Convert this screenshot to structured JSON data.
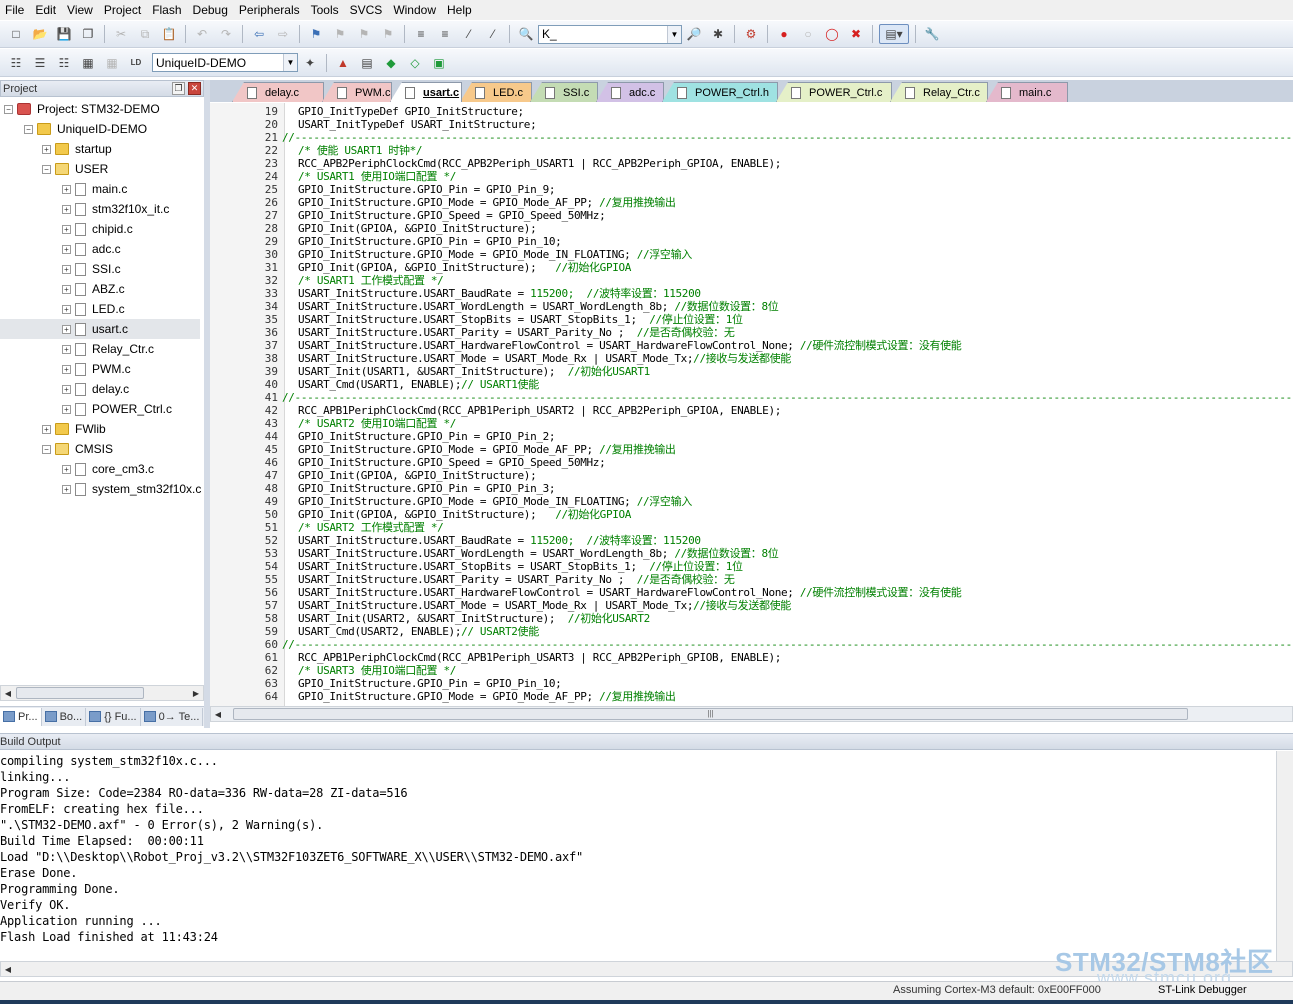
{
  "menu": [
    "File",
    "Edit",
    "View",
    "Project",
    "Flash",
    "Debug",
    "Peripherals",
    "Tools",
    "SVCS",
    "Window",
    "Help"
  ],
  "toolbar": {
    "find_value": "K_",
    "target_value": "UniqueID-DEMO"
  },
  "project_pane": {
    "title": "Project",
    "pin_glyph": "❐",
    "close_glyph": "✕",
    "tree": [
      {
        "label": "Project: STM32-DEMO",
        "kind": "project",
        "indent": 0,
        "expander": "−"
      },
      {
        "label": "UniqueID-DEMO",
        "kind": "target",
        "indent": 1,
        "expander": "−"
      },
      {
        "label": "startup",
        "kind": "folder",
        "indent": 2,
        "expander": "+"
      },
      {
        "label": "USER",
        "kind": "folder-open",
        "indent": 2,
        "expander": "−"
      },
      {
        "label": "main.c",
        "kind": "file",
        "indent": 3,
        "expander": "+"
      },
      {
        "label": "stm32f10x_it.c",
        "kind": "file",
        "indent": 3,
        "expander": "+"
      },
      {
        "label": "chipid.c",
        "kind": "file",
        "indent": 3,
        "expander": "+"
      },
      {
        "label": "adc.c",
        "kind": "file",
        "indent": 3,
        "expander": "+"
      },
      {
        "label": "SSI.c",
        "kind": "file",
        "indent": 3,
        "expander": "+"
      },
      {
        "label": "ABZ.c",
        "kind": "file",
        "indent": 3,
        "expander": "+"
      },
      {
        "label": "LED.c",
        "kind": "file",
        "indent": 3,
        "expander": "+"
      },
      {
        "label": "usart.c",
        "kind": "file",
        "indent": 3,
        "expander": "+",
        "selected": true
      },
      {
        "label": "Relay_Ctr.c",
        "kind": "file",
        "indent": 3,
        "expander": "+"
      },
      {
        "label": "PWM.c",
        "kind": "file",
        "indent": 3,
        "expander": "+"
      },
      {
        "label": "delay.c",
        "kind": "file",
        "indent": 3,
        "expander": "+"
      },
      {
        "label": "POWER_Ctrl.c",
        "kind": "file",
        "indent": 3,
        "expander": "+"
      },
      {
        "label": "FWlib",
        "kind": "folder",
        "indent": 2,
        "expander": "+"
      },
      {
        "label": "CMSIS",
        "kind": "folder-open",
        "indent": 2,
        "expander": "−"
      },
      {
        "label": "core_cm3.c",
        "kind": "file",
        "indent": 3,
        "expander": "+"
      },
      {
        "label": "system_stm32f10x.c",
        "kind": "file",
        "indent": 3,
        "expander": "+"
      }
    ],
    "bottom_tabs": [
      {
        "label": "Pr...",
        "active": true
      },
      {
        "label": "Bo...",
        "active": false
      },
      {
        "label": "{} Fu...",
        "active": false
      },
      {
        "label": "0→ Te...",
        "active": false
      }
    ]
  },
  "editor_tabs": [
    {
      "label": "delay.c",
      "color": "#f1c6c6",
      "active": false
    },
    {
      "label": "PWM.c",
      "color": "#f1c6c6",
      "active": false
    },
    {
      "label": "usart.c",
      "color": "#ffffff",
      "active": true
    },
    {
      "label": "LED.c",
      "color": "#f7c98b",
      "active": false
    },
    {
      "label": "SSI.c",
      "color": "#c4dcb4",
      "active": false
    },
    {
      "label": "adc.c",
      "color": "#d2c1e6",
      "active": false
    },
    {
      "label": "POWER_Ctrl.h",
      "color": "#9fe2e2",
      "active": false
    },
    {
      "label": "POWER_Ctrl.c",
      "color": "#e5f0c8",
      "active": false
    },
    {
      "label": "Relay_Ctr.c",
      "color": "#e5f0c8",
      "active": false
    },
    {
      "label": "main.c",
      "color": "#e4b9cc",
      "active": false
    }
  ],
  "code": {
    "first_line": 19,
    "lines": [
      {
        "code": "GPIO_InitTypeDef GPIO_InitStructure;",
        "comment": ""
      },
      {
        "code": "USART_InitTypeDef USART_InitStructure;",
        "comment": ""
      },
      {
        "code": "",
        "comment": "",
        "separator": true
      },
      {
        "code": "",
        "comment": "/* 使能 USART1 时钟*/"
      },
      {
        "code": "RCC_APB2PeriphClockCmd(RCC_APB2Periph_USART1 | RCC_APB2Periph_GPIOA, ENABLE);",
        "comment": ""
      },
      {
        "code": "",
        "comment": "/* USART1 使用IO端口配置 */"
      },
      {
        "code": "GPIO_InitStructure.GPIO_Pin = GPIO_Pin_9;",
        "comment": ""
      },
      {
        "code": "GPIO_InitStructure.GPIO_Mode = GPIO_Mode_AF_PP; ",
        "comment": "//复用推挽输出"
      },
      {
        "code": "GPIO_InitStructure.GPIO_Speed = GPIO_Speed_50MHz;",
        "comment": ""
      },
      {
        "code": "GPIO_Init(GPIOA, &GPIO_InitStructure);",
        "comment": ""
      },
      {
        "code": "GPIO_InitStructure.GPIO_Pin = GPIO_Pin_10;",
        "comment": ""
      },
      {
        "code": "GPIO_InitStructure.GPIO_Mode = GPIO_Mode_IN_FLOATING; ",
        "comment": "//浮空输入"
      },
      {
        "code": "GPIO_Init(GPIOA, &GPIO_InitStructure);   ",
        "comment": "//初始化GPIOA"
      },
      {
        "code": "",
        "comment": "/* USART1 工作模式配置 */"
      },
      {
        "code": "USART_InitStructure.USART_BaudRate = ",
        "comment": "115200;  //波特率设置：115200"
      },
      {
        "code": "USART_InitStructure.USART_WordLength = USART_WordLength_8b; ",
        "comment": "//数据位数设置：8位"
      },
      {
        "code": "USART_InitStructure.USART_StopBits = USART_StopBits_1;  ",
        "comment": "//停止位设置：1位"
      },
      {
        "code": "USART_InitStructure.USART_Parity = USART_Parity_No ;  ",
        "comment": "//是否奇偶校验：无"
      },
      {
        "code": "USART_InitStructure.USART_HardwareFlowControl = USART_HardwareFlowControl_None; ",
        "comment": "//硬件流控制模式设置：没有使能"
      },
      {
        "code": "USART_InitStructure.USART_Mode = USART_Mode_Rx | USART_Mode_Tx;",
        "comment": "//接收与发送都使能"
      },
      {
        "code": "USART_Init(USART1, &USART_InitStructure);  ",
        "comment": "//初始化USART1"
      },
      {
        "code": "USART_Cmd(USART1, ENABLE);",
        "comment": "// USART1使能"
      },
      {
        "code": "",
        "comment": "",
        "separator": true
      },
      {
        "code": "RCC_APB1PeriphClockCmd(RCC_APB1Periph_USART2 | RCC_APB2Periph_GPIOA, ENABLE);",
        "comment": ""
      },
      {
        "code": "",
        "comment": "/* USART2 使用IO端口配置 */"
      },
      {
        "code": "GPIO_InitStructure.GPIO_Pin = GPIO_Pin_2;",
        "comment": ""
      },
      {
        "code": "GPIO_InitStructure.GPIO_Mode = GPIO_Mode_AF_PP; ",
        "comment": "//复用推挽输出"
      },
      {
        "code": "GPIO_InitStructure.GPIO_Speed = GPIO_Speed_50MHz;",
        "comment": ""
      },
      {
        "code": "GPIO_Init(GPIOA, &GPIO_InitStructure);",
        "comment": ""
      },
      {
        "code": "GPIO_InitStructure.GPIO_Pin = GPIO_Pin_3;",
        "comment": ""
      },
      {
        "code": "GPIO_InitStructure.GPIO_Mode = GPIO_Mode_IN_FLOATING; ",
        "comment": "//浮空输入"
      },
      {
        "code": "GPIO_Init(GPIOA, &GPIO_InitStructure);   ",
        "comment": "//初始化GPIOA"
      },
      {
        "code": "",
        "comment": "/* USART2 工作模式配置 */"
      },
      {
        "code": "USART_InitStructure.USART_BaudRate = ",
        "comment": "115200;  //波特率设置：115200"
      },
      {
        "code": "USART_InitStructure.USART_WordLength = USART_WordLength_8b; ",
        "comment": "//数据位数设置：8位"
      },
      {
        "code": "USART_InitStructure.USART_StopBits = USART_StopBits_1;  ",
        "comment": "//停止位设置：1位"
      },
      {
        "code": "USART_InitStructure.USART_Parity = USART_Parity_No ;  ",
        "comment": "//是否奇偶校验：无"
      },
      {
        "code": "USART_InitStructure.USART_HardwareFlowControl = USART_HardwareFlowControl_None; ",
        "comment": "//硬件流控制模式设置：没有使能"
      },
      {
        "code": "USART_InitStructure.USART_Mode = USART_Mode_Rx | USART_Mode_Tx;",
        "comment": "//接收与发送都使能"
      },
      {
        "code": "USART_Init(USART2, &USART_InitStructure);  ",
        "comment": "//初始化USART2"
      },
      {
        "code": "USART_Cmd(USART2, ENABLE);",
        "comment": "// USART2使能"
      },
      {
        "code": "",
        "comment": "",
        "separator": true
      },
      {
        "code": "RCC_APB1PeriphClockCmd(RCC_APB1Periph_USART3 | RCC_APB2Periph_GPIOB, ENABLE);",
        "comment": ""
      },
      {
        "code": "",
        "comment": "/* USART3 使用IO端口配置 */"
      },
      {
        "code": "GPIO_InitStructure.GPIO_Pin = GPIO_Pin_10;",
        "comment": ""
      },
      {
        "code": "GPIO_InitStructure.GPIO_Mode = GPIO_Mode_AF_PP; ",
        "comment": "//复用推挽输出"
      }
    ]
  },
  "build_output": {
    "title": "Build Output",
    "lines": [
      "compiling system_stm32f10x.c...",
      "linking...",
      "Program Size: Code=2384 RO-data=336 RW-data=28 ZI-data=516",
      "FromELF: creating hex file...",
      "\".\\STM32-DEMO.axf\" - 0 Error(s), 2 Warning(s).",
      "Build Time Elapsed:  00:00:11",
      "Load \"D:\\\\Desktop\\\\Robot_Proj_v3.2\\\\STM32F103ZET6_SOFTWARE_X\\\\USER\\\\STM32-DEMO.axf\"",
      "Erase Done.",
      "Programming Done.",
      "Verify OK.",
      "Application running ...",
      "Flash Load finished at 11:43:24"
    ]
  },
  "status": {
    "cpu": "Assuming Cortex-M3 default: 0xE00FF000",
    "debugger": "ST-Link Debugger"
  },
  "watermark": {
    "brand": "STM32/STM8社区",
    "url": "www.stmcu.org"
  },
  "colors": {
    "comment": "#008000",
    "number": "#008000",
    "accent": "#3b6fb6"
  }
}
